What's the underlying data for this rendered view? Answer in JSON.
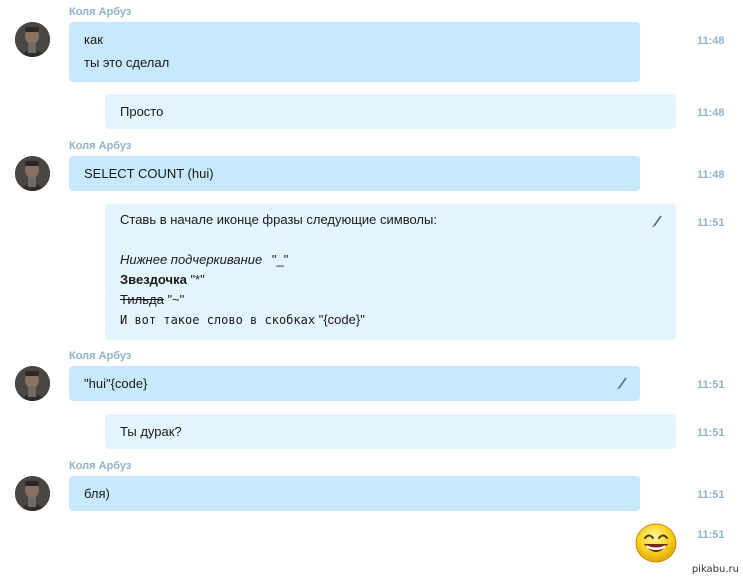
{
  "sender_name": "Коля Арбуз",
  "messages": [
    {
      "lines": [
        "как",
        "ты это сделал"
      ],
      "time": "11:48"
    },
    {
      "lines": [
        "Просто"
      ],
      "time": "11:48"
    },
    {
      "lines": [
        "SELECT COUNT (hui)"
      ],
      "time": "11:48"
    },
    {
      "intro": "Ставь в начале иконце фразы следующие символы:",
      "italic_label": "Нижнее подчеркивание",
      "italic_symbol": "\"_\"",
      "bold_label": "Звездочка",
      "bold_symbol": "\"*\"",
      "strike_label": "Тильда",
      "strike_symbol": "\"~\"",
      "mono_text": "И вот такое слово в скобках",
      "mono_symbol": "\"{code}\"",
      "time": "11:51"
    },
    {
      "lines": [
        "\"hui\"{code}"
      ],
      "time": "11:51"
    },
    {
      "lines": [
        "Ты дурак?"
      ],
      "time": "11:51"
    },
    {
      "lines": [
        "бля)"
      ],
      "time": "11:51"
    },
    {
      "emoji": "laughing-emoticon",
      "time": "11:51"
    }
  ],
  "watermark": "pikabu.ru",
  "icons": {
    "edited": "pencil-icon"
  },
  "colors": {
    "incoming_bubble": "#c7e9fb",
    "outgoing_bubble": "#e4f5fd",
    "meta_text": "#8fb3c9"
  }
}
